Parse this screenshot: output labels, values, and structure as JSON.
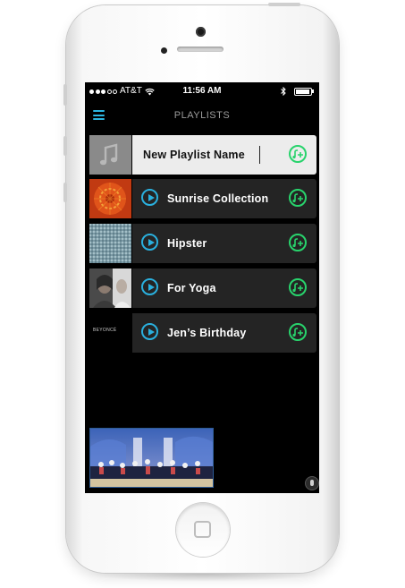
{
  "status_bar": {
    "carrier": "AT&T",
    "time": "11:56 AM"
  },
  "nav": {
    "title": "PLAYLISTS"
  },
  "new_playlist": {
    "value": "New Playlist Name"
  },
  "playlists": [
    {
      "name": "Sunrise Collection"
    },
    {
      "name": "Hipster"
    },
    {
      "name": "For Yoga"
    },
    {
      "name": "Jen’s Birthday"
    }
  ],
  "thumb_text": {
    "beyonce": "BEYONCÉ"
  },
  "colors": {
    "accent_blue": "#2ab0de",
    "accent_green": "#28d36c",
    "row_bg": "#242424",
    "screen_bg": "#000000"
  },
  "icons": {
    "menu": "hamburger-icon",
    "play": "play-icon",
    "add": "add-to-playlist-icon",
    "music": "music-note-icon",
    "mic": "microphone-icon"
  }
}
